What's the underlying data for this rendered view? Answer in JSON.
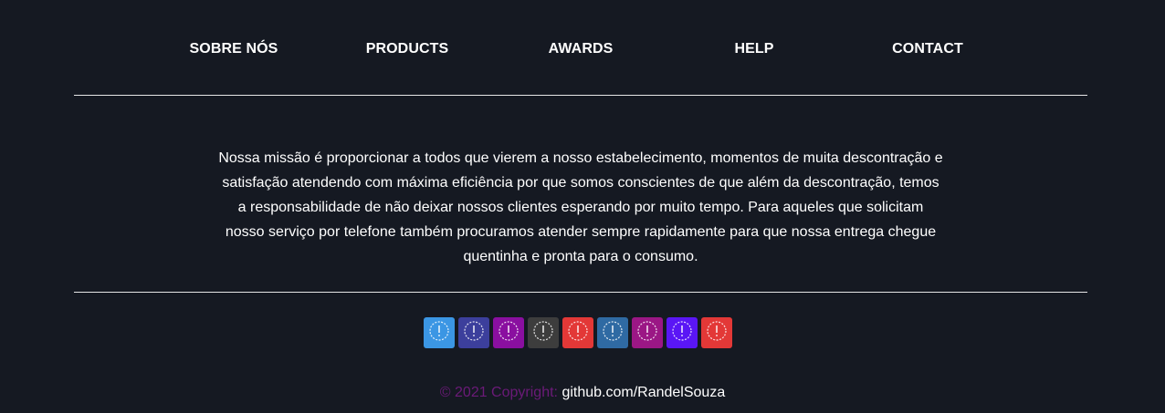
{
  "nav": {
    "items": [
      {
        "label": "SOBRE NÓS"
      },
      {
        "label": "PRODUCTS"
      },
      {
        "label": "AWARDS"
      },
      {
        "label": "HELP"
      },
      {
        "label": "CONTACT"
      }
    ]
  },
  "mission": {
    "text": "Nossa missão é proporcionar a todos que vierem a nosso estabelecimento, momentos de muita descontração e satisfação atendendo com máxima eficiência por que somos conscientes de que além da descontração, temos a responsabilidade de não deixar nossos clientes esperando por muito tempo. Para aqueles que solicitam nosso serviço por telefone também procuramos atender sempre rapidamente para que nossa entrega chegue quentinha e pronta para o consumo."
  },
  "social": {
    "icon": "broken-icon-placeholder",
    "buttons": [
      {
        "color": "#3b96e4"
      },
      {
        "color": "#3c3f9c"
      },
      {
        "color": "#8a0fa0"
      },
      {
        "color": "#3d3d3d"
      },
      {
        "color": "#e33837"
      },
      {
        "color": "#2f6aa3"
      },
      {
        "color": "#9b1785"
      },
      {
        "color": "#5a16f5"
      },
      {
        "color": "#e33837"
      }
    ]
  },
  "footer": {
    "copyright_label": "© 2021 Copyright:",
    "link_text": "github.com/RandelSouza",
    "label_color": "#6b1a78"
  }
}
